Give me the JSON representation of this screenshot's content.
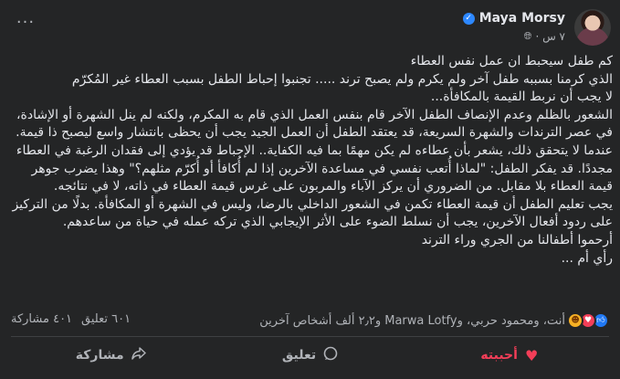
{
  "author": {
    "name": "Maya Morsy",
    "time": "٧ س ·"
  },
  "post": {
    "lines": [
      "كم طفل سيحبط ان عمل نفس العطاء",
      "الذي كرمنا بسببه طفل آخر ولم يكرم ولم يصبح ترند ..... تجنبوا إحباط الطفل بسبب العطاء غير المُكرّم",
      "لا يجب أن نربط القيمة بالمكافأة...",
      "الشعور بالظلم وعدم الإنصاف الطفل الآخر قام بنفس العمل الذي قام به المكرم، ولكنه لم ينل الشهرة أو الإشادة، في عصر الترندات والشهرة السريعة، قد يعتقد الطفل أن العمل الجيد يجب أن يحظى بانتشار واسع ليصبح ذا قيمة. عندما لا يتحقق ذلك، يشعر بأن عطاءه لم يكن مهمًا بما فيه الكفاية.. الإحباط قد يؤدي إلى فقدان الرغبة في العطاء مجددًا. قد يفكر الطفل: \"لماذا أُتعب نفسي في مساعدة الآخرين إذا لم أُكافأ أو أُكرّم مثلهم؟\" وهذا يضرب جوهر قيمة العطاء بلا مقابل. من الضروري أن يركز الآباء والمربون على غرس قيمة العطاء في ذاته، لا في نتائجه.",
      "يجب تعليم الطفل أن قيمة العطاء تكمن في الشعور الداخلي بالرضا، وليس في الشهرة أو المكافأة. بدلًا من التركيز على ردود أفعال الآخرين، يجب أن نسلط الضوء على الأثر الإيجابي الذي تركه عمله في حياة من ساعدهم.",
      "أرحموا أطفالنا من الجري وراء الترند",
      "رأي أم ..."
    ]
  },
  "stats": {
    "reactions_text": "أنت، ومحمود حربي، وMarwa Lotfy و٢٫٢ ألف أشخاص آخرين",
    "comments": "٦٠١ تعليق",
    "shares": "٤٠١ مشاركة"
  },
  "actions": {
    "like": "أحببته",
    "comment": "تعليق",
    "share": "مشاركة"
  },
  "colors": {
    "background": "#242526",
    "text": "#e4e6eb",
    "muted": "#b0b3b8",
    "love": "#f33e58",
    "like": "#2078f4",
    "verified": "#2d88ff"
  },
  "icons": [
    "verified-icon",
    "globe-icon",
    "more-icon",
    "like-reaction-icon",
    "love-reaction-icon",
    "care-reaction-icon",
    "heart-icon",
    "comment-icon",
    "share-icon"
  ]
}
